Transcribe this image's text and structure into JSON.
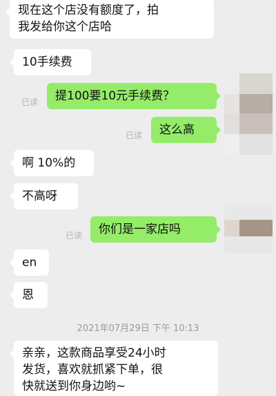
{
  "messages": {
    "m1": {
      "lines": [
        "现在这个店没有额度了，拍",
        "我发给你这个店哈"
      ]
    },
    "m2": {
      "text": "10手续费"
    },
    "m3": {
      "text": "提100要10元手续费？",
      "read": "已读"
    },
    "m4": {
      "text": "这么高",
      "read": "已读"
    },
    "m5": {
      "text": "啊 10%的"
    },
    "m6": {
      "text": "不高呀"
    },
    "m7": {
      "text": "你们是一家店吗",
      "read": "已读"
    },
    "m8": {
      "text": "en"
    },
    "m9": {
      "text": "恩"
    },
    "m10": {
      "lines": [
        "亲亲，这款商品享受24小时",
        "发货，喜欢就抓紧下单，很",
        "快就送到你身边哟~"
      ]
    }
  },
  "timestamp": "2021年07月29日 下午 10:13",
  "colors": {
    "background": "#ededed",
    "incoming_bubble": "#ffffff",
    "outgoing_bubble": "#95ec69",
    "read_text": "#b2b2b2"
  },
  "avatar": {
    "icon": "blurred-avatar-icon"
  }
}
